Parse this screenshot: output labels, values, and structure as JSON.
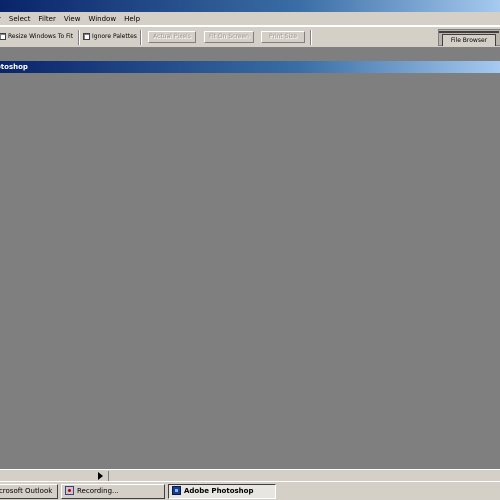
{
  "menubar": {
    "items": [
      "r",
      "Select",
      "Filter",
      "View",
      "Window",
      "Help"
    ]
  },
  "options_bar": {
    "resize_windows_label": "Resize Windows To Fit",
    "ignore_palettes_label": "Ignore Palettes",
    "actual_pixels_label": "Actual Pixels",
    "fit_on_screen_label": "Fit On Screen",
    "print_size_label": "Print Size"
  },
  "palette_well": {
    "file_browser_label": "File Browser"
  },
  "app_window": {
    "title": "otoshop"
  },
  "taskbar": {
    "items": [
      {
        "label": "icrosoft Outlook",
        "active": false
      },
      {
        "label": "Recording...",
        "active": false
      },
      {
        "label": "Adobe Photoshop",
        "active": true
      }
    ]
  },
  "colors": {
    "titlebar_start": "#0a246a",
    "titlebar_end": "#a6caf0",
    "workspace": "#7f7f7f",
    "chrome": "#d4d0c8"
  }
}
